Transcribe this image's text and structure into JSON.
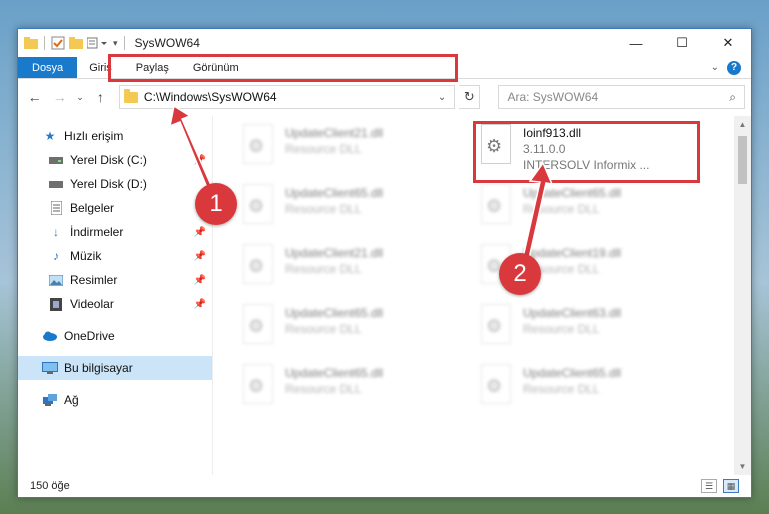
{
  "window": {
    "title": "SysWOW64"
  },
  "titlebar": {
    "minimize": "—",
    "maximize": "☐",
    "close": "✕"
  },
  "ribbon": {
    "tabs": [
      "Dosya",
      "Giriş",
      "Paylaş",
      "Görünüm"
    ]
  },
  "address": {
    "path": "C:\\Windows\\SysWOW64"
  },
  "search": {
    "placeholder": "Ara: SysWOW64"
  },
  "sidebar": {
    "items": [
      {
        "label": "Hızlı erişim",
        "icon": "star-icon",
        "pinned": false
      },
      {
        "label": "Yerel Disk (C:)",
        "icon": "drive-icon",
        "pinned": true
      },
      {
        "label": "Yerel Disk (D:)",
        "icon": "drive-icon",
        "pinned": true
      },
      {
        "label": "Belgeler",
        "icon": "document-icon",
        "pinned": true
      },
      {
        "label": "İndirmeler",
        "icon": "download-icon",
        "pinned": true
      },
      {
        "label": "Müzik",
        "icon": "music-icon",
        "pinned": true
      },
      {
        "label": "Resimler",
        "icon": "picture-icon",
        "pinned": true
      },
      {
        "label": "Videolar",
        "icon": "video-icon",
        "pinned": true
      },
      {
        "label": "OneDrive",
        "icon": "cloud-icon",
        "pinned": false
      },
      {
        "label": "Bu bilgisayar",
        "icon": "computer-icon",
        "pinned": false,
        "selected": true
      },
      {
        "label": "Ağ",
        "icon": "network-icon",
        "pinned": false
      }
    ]
  },
  "files": {
    "left": [
      {
        "name": "UpdateClient21.dll",
        "desc": "Resource DLL"
      },
      {
        "name": "UpdateClient65.dll",
        "desc": "Resource DLL"
      },
      {
        "name": "UpdateClient21.dll",
        "desc": "Resource DLL"
      },
      {
        "name": "UpdateClient65.dll",
        "desc": "Resource DLL"
      },
      {
        "name": "UpdateClient65.dll",
        "desc": "Resource DLL"
      }
    ],
    "right": [
      {
        "name": "Ioinf913.dll",
        "version": "3.11.0.0",
        "desc": "INTERSOLV Informix ...",
        "highlighted": true
      },
      {
        "name": "UpdateClient65.dll",
        "desc": "Resource DLL"
      },
      {
        "name": "UpdateClient19.dll",
        "desc": "Resource DLL"
      },
      {
        "name": "UpdateClient63.dll",
        "desc": "Resource DLL"
      },
      {
        "name": "UpdateClient65.dll",
        "desc": "Resource DLL"
      }
    ]
  },
  "status": {
    "count": "150 öğe"
  },
  "annotations": [
    {
      "label": "1"
    },
    {
      "label": "2"
    }
  ],
  "colors": {
    "accent": "#1979ca",
    "highlight": "#d9393c",
    "folder": "#f3c954"
  }
}
